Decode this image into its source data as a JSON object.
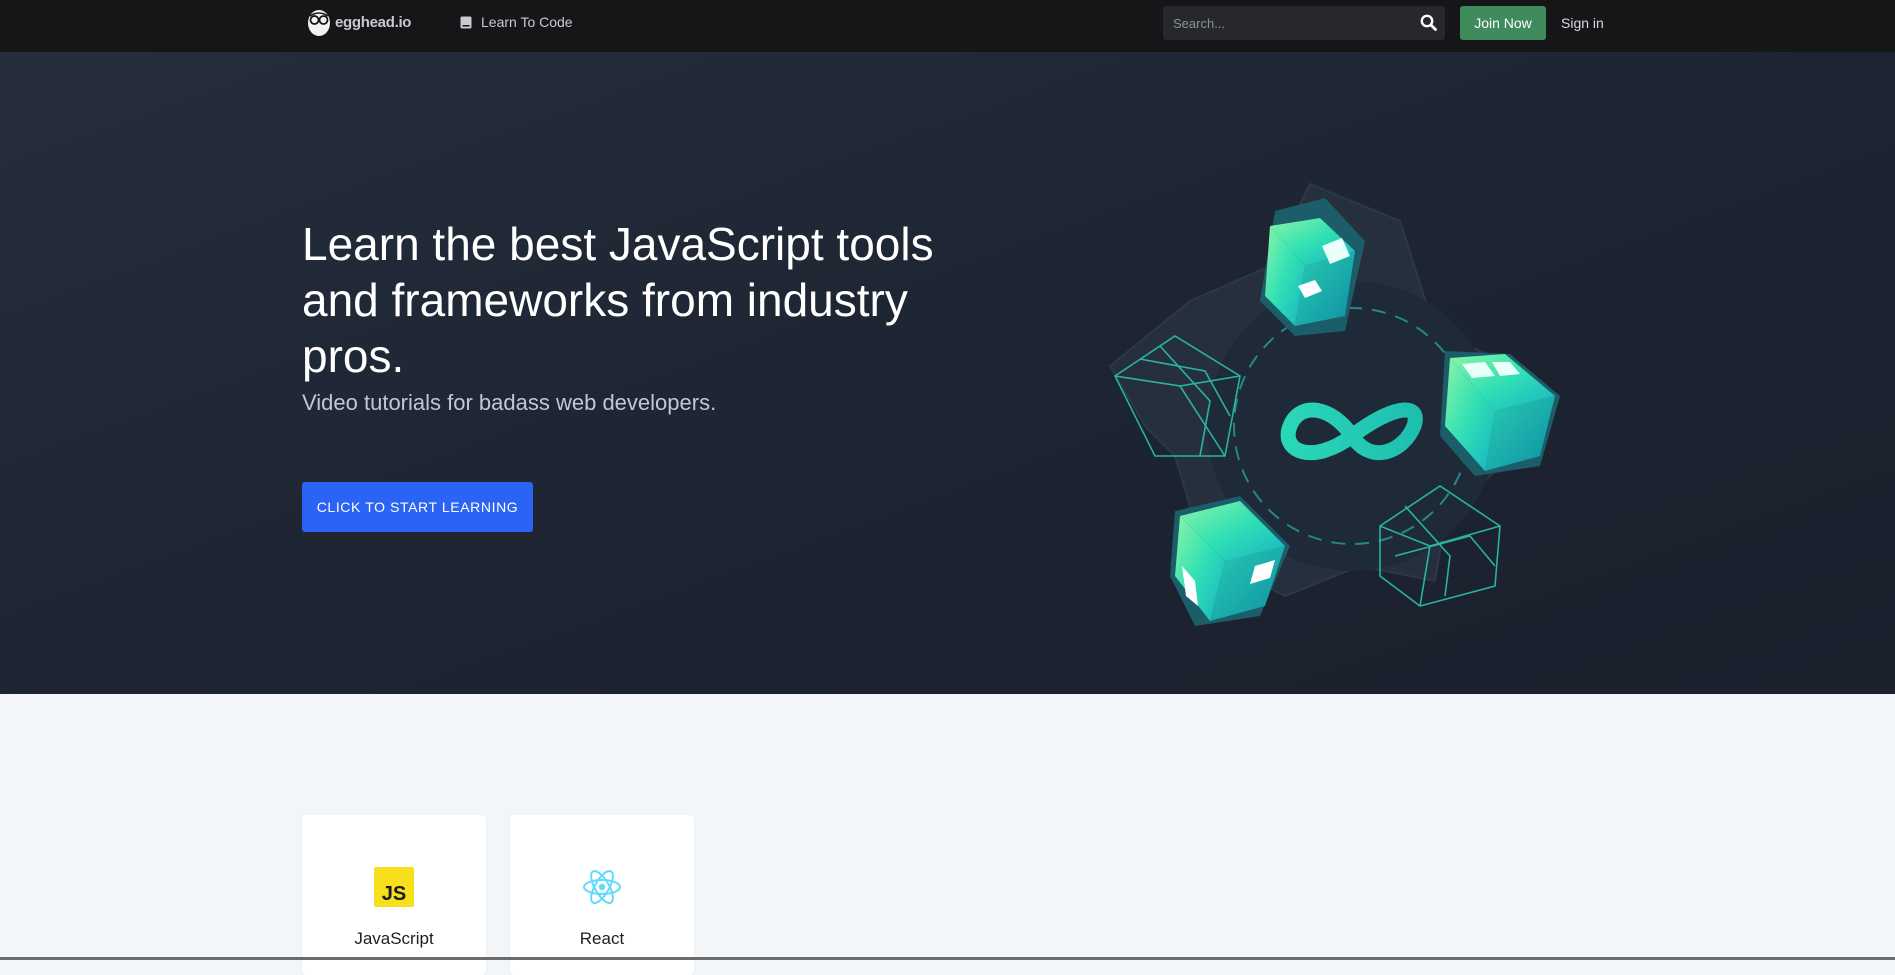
{
  "nav": {
    "logo_text": "egghead.io",
    "link_label": "Learn To Code",
    "search_placeholder": "Search...",
    "join_label": "Join Now",
    "signin_label": "Sign in"
  },
  "hero": {
    "title": "Learn the best JavaScript tools and frameworks from industry pros.",
    "subtitle": "Video tutorials for badass web developers.",
    "cta_label": "CLICK TO START LEARNING"
  },
  "cards": [
    {
      "label": "JavaScript",
      "icon": "javascript-icon",
      "icon_text": "JS",
      "color": "#f7df1e"
    },
    {
      "label": "React",
      "icon": "react-icon",
      "color": "#61dafb"
    }
  ],
  "colors": {
    "nav_bg": "#151618",
    "join_button": "#3f8b5c",
    "cta_button": "#2b64f5",
    "accent_teal": "#2ad7b8"
  }
}
